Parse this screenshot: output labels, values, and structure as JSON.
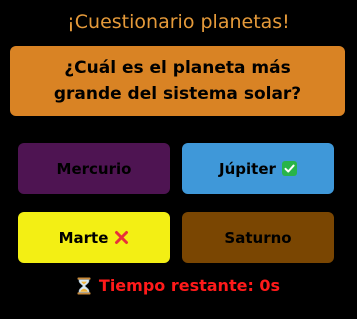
{
  "header": {
    "title": "¡Cuestionario planetas!"
  },
  "question": {
    "text": "¿Cuál es el planeta más grande del sistema solar?"
  },
  "options": [
    {
      "label": "Mercurio",
      "status": "none"
    },
    {
      "label": "Júpiter",
      "status": "correct",
      "icon": "check-icon"
    },
    {
      "label": "Marte",
      "status": "wrong",
      "icon": "cross-icon"
    },
    {
      "label": "Saturno",
      "status": "none"
    }
  ],
  "timer": {
    "icon": "hourglass-icon",
    "text": "Tiempo restante: 0s"
  },
  "colors": {
    "background": "#000000",
    "title": "#e59a3a",
    "question_bg": "#d98324",
    "option_mercurio": "#4e1452",
    "option_jupiter": "#3f98d9",
    "option_marte": "#f3ef14",
    "option_saturno": "#7a4602",
    "timer": "#ff1a1a",
    "check": "#28b44a",
    "cross": "#e8303a"
  }
}
